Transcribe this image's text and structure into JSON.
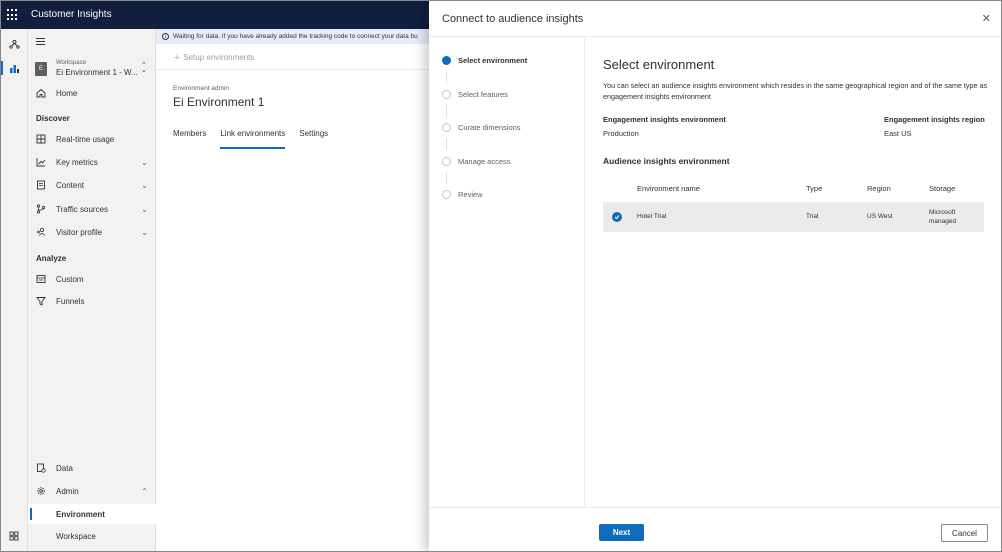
{
  "app": {
    "title": "Customer Insights"
  },
  "nav": {
    "workspace_avatar": "E",
    "workspace_label": "Workspace",
    "workspace_name": "Ei Environment 1 - W...",
    "home": "Home",
    "section_discover": "Discover",
    "discover_items": [
      "Real-time usage",
      "Key metrics",
      "Content",
      "Traffic sources",
      "Visitor profile"
    ],
    "section_analyze": "Analyze",
    "analyze_items": [
      "Custom",
      "Funnels"
    ],
    "data": "Data",
    "admin": "Admin",
    "environment": "Environment",
    "workspace": "Workspace"
  },
  "main": {
    "info_text": "Waiting for data. If you have already added the tracking code to connect your data bu",
    "setup_button": "Setup environments",
    "env_admin_label": "Environment admin",
    "env_title": "Ei Environment 1",
    "tabs": [
      "Members",
      "Link environments",
      "Settings"
    ],
    "active_tab": "Link environments"
  },
  "panel": {
    "title": "Connect to audience insights",
    "steps": [
      "Select environment",
      "Select features",
      "Curate dimensions",
      "Manage access",
      "Review"
    ],
    "active_step": "Select environment",
    "content": {
      "title": "Select environment",
      "description": "You can select an audience insights environment which resides in the same geographical region and of the same type as engagement insights environment",
      "ei_env_label": "Engagement insights environment",
      "ei_env_value": "Production",
      "ei_region_label": "Engagement insights region",
      "ei_region_value": "East US",
      "ai_heading": "Audience insights environment",
      "columns": [
        "Environment name",
        "Type",
        "Region",
        "Storage"
      ],
      "rows": [
        {
          "name": "Hotel Trial",
          "type": "Trial",
          "region": "US West",
          "storage_line1": "Microsoft",
          "storage_line2": "managed",
          "selected": true
        }
      ]
    },
    "next_button": "Next",
    "cancel_button": "Cancel"
  },
  "colors": {
    "topbar": "#0f1f3d",
    "accent": "#0f6cbd",
    "infobar": "#e8ebfa"
  }
}
